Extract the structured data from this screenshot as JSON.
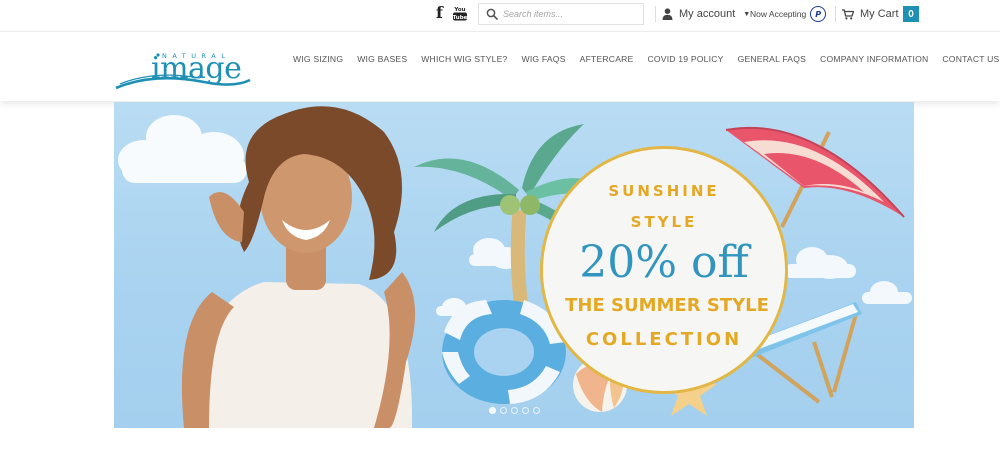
{
  "topbar": {
    "social": [
      {
        "name": "facebook-icon",
        "glyph": "f"
      },
      {
        "name": "youtube-icon",
        "glyph": "You Tube"
      }
    ],
    "search_placeholder": "Search items...",
    "account_label": "My account",
    "accepting_label": "Now Accepting",
    "payment_icon": "paypal-icon",
    "cart_label": "My Cart",
    "cart_count": "0"
  },
  "brand": {
    "logo_top": "NATURAL",
    "logo_main": "image",
    "color": "#1e8fb5"
  },
  "nav": {
    "items": [
      {
        "label": "WIG SIZING"
      },
      {
        "label": "WIG BASES"
      },
      {
        "label": "WHICH WIG STYLE?"
      },
      {
        "label": "WIG FAQS"
      },
      {
        "label": "AFTERCARE"
      },
      {
        "label": "COVID 19 POLICY"
      },
      {
        "label": "GENERAL FAQS"
      },
      {
        "label": "COMPANY INFORMATION"
      },
      {
        "label": "CONTACT US"
      }
    ]
  },
  "hero": {
    "promo": {
      "line1": "SUNSHINE",
      "line2": "STYLE",
      "line3": "20% off",
      "line4": "THE SUMMER STYLE",
      "line5": "COLLECTION"
    },
    "slide_count": 5,
    "active_slide": 1
  }
}
